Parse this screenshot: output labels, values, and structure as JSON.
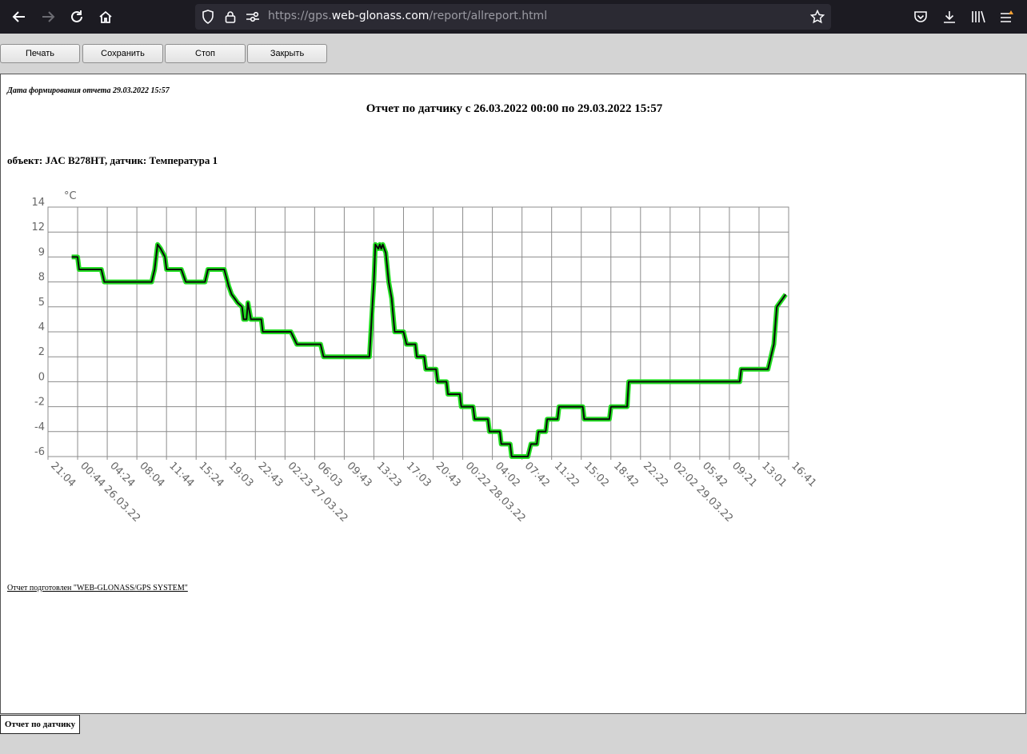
{
  "browser": {
    "url_prefix": "https://gps.",
    "url_domain": "web-glonass.com",
    "url_path": "/report/allreport.html",
    "icons": [
      "back-arrow-icon",
      "forward-arrow-icon",
      "reload-icon",
      "home-icon",
      "shield-icon",
      "lock-icon",
      "permissions-icon",
      "bookmark-star-icon",
      "pocket-icon",
      "download-icon",
      "library-icon",
      "menu-icon"
    ]
  },
  "toolbar": {
    "print_label": "Печать",
    "save_label": "Сохранить",
    "stop_label": "Стоп",
    "close_label": "Закрыть"
  },
  "report": {
    "generated": "Дата формирования отчета 29.03.2022 15:57",
    "title": "Отчет по датчику с 26.03.2022 00:00 по 29.03.2022 15:57",
    "object_line": "объект: JAC B278HT, датчик: Температура 1",
    "footer": "Отчет подготовлен \"WEB-GLONASS/GPS SYSTEM\"",
    "tab_label": "Отчет по датчику"
  },
  "chart_data": {
    "type": "line",
    "y_unit": "°C",
    "y_ticks": [
      "14",
      "12",
      "9",
      "8",
      "5",
      "4",
      "2",
      "0",
      "-2",
      "-4",
      "-6"
    ],
    "x_ticks": [
      "21:04",
      "00:44 26.03.22",
      "04:24",
      "08:04",
      "11:44",
      "15:24",
      "19:03",
      "22:43",
      "02:23 27.03.22",
      "06:03",
      "09:43",
      "13:23",
      "17:03",
      "20:43",
      "00:22 28.03.22",
      "04:02",
      "07:42",
      "11:22",
      "15:02",
      "18:42",
      "22:22",
      "02:02 29.03.22",
      "05:42",
      "09:21",
      "13:01",
      "16:41"
    ],
    "colors": {
      "series": "#22dd22",
      "shadow": "#0a0a0a",
      "grid": "#8c8c8c",
      "axis_text": "#666666"
    },
    "series": [
      {
        "points": [
          [
            0.8,
            9
          ],
          [
            1.0,
            9
          ],
          [
            1.05,
            8.5
          ],
          [
            1.1,
            8.5
          ],
          [
            1.8,
            8.5
          ],
          [
            1.9,
            8
          ],
          [
            3.5,
            8
          ],
          [
            3.6,
            8.5
          ],
          [
            3.7,
            10.5
          ],
          [
            3.8,
            10
          ],
          [
            3.95,
            9
          ],
          [
            4.0,
            8.5
          ],
          [
            4.5,
            8.5
          ],
          [
            4.65,
            8
          ],
          [
            5.3,
            8
          ],
          [
            5.4,
            8.5
          ],
          [
            5.95,
            8.5
          ],
          [
            6.1,
            7.5
          ],
          [
            6.2,
            6.5
          ],
          [
            6.3,
            6
          ],
          [
            6.4,
            5.5
          ],
          [
            6.55,
            5
          ],
          [
            6.6,
            4.5
          ],
          [
            6.7,
            4.5
          ],
          [
            6.75,
            5.5
          ],
          [
            6.85,
            4.5
          ],
          [
            7.2,
            4.5
          ],
          [
            7.25,
            4
          ],
          [
            8.2,
            4
          ],
          [
            8.3,
            3.5
          ],
          [
            8.4,
            3
          ],
          [
            9.2,
            3
          ],
          [
            9.3,
            2
          ],
          [
            10.85,
            2
          ],
          [
            10.9,
            4
          ],
          [
            11.0,
            8
          ],
          [
            11.05,
            10.5
          ],
          [
            11.15,
            10
          ],
          [
            11.2,
            10.5
          ],
          [
            11.25,
            10
          ],
          [
            11.3,
            10.5
          ],
          [
            11.35,
            10
          ],
          [
            11.4,
            9.5
          ],
          [
            11.5,
            8
          ],
          [
            11.6,
            6
          ],
          [
            11.7,
            4
          ],
          [
            12.0,
            4
          ],
          [
            12.1,
            3
          ],
          [
            12.4,
            3
          ],
          [
            12.45,
            2
          ],
          [
            12.7,
            2
          ],
          [
            12.75,
            1
          ],
          [
            13.1,
            1
          ],
          [
            13.15,
            0
          ],
          [
            13.45,
            0
          ],
          [
            13.5,
            -1
          ],
          [
            13.9,
            -1
          ],
          [
            13.95,
            -2
          ],
          [
            14.35,
            -2
          ],
          [
            14.4,
            -3
          ],
          [
            14.85,
            -3
          ],
          [
            14.9,
            -4
          ],
          [
            15.25,
            -4
          ],
          [
            15.3,
            -5
          ],
          [
            15.6,
            -5
          ],
          [
            15.65,
            -6
          ],
          [
            16.2,
            -6
          ],
          [
            16.3,
            -5
          ],
          [
            16.5,
            -5
          ],
          [
            16.55,
            -4
          ],
          [
            16.8,
            -4
          ],
          [
            16.85,
            -3
          ],
          [
            17.2,
            -3
          ],
          [
            17.25,
            -2
          ],
          [
            18.05,
            -2
          ],
          [
            18.1,
            -3
          ],
          [
            18.95,
            -3
          ],
          [
            19.0,
            -2
          ],
          [
            19.55,
            -2
          ],
          [
            19.6,
            0
          ],
          [
            23.35,
            0
          ],
          [
            23.4,
            1
          ],
          [
            24.3,
            1
          ],
          [
            24.4,
            2
          ],
          [
            24.5,
            3
          ],
          [
            24.6,
            5
          ],
          [
            24.7,
            5.5
          ],
          [
            24.8,
            6
          ],
          [
            24.9,
            6.5
          ]
        ]
      }
    ]
  }
}
